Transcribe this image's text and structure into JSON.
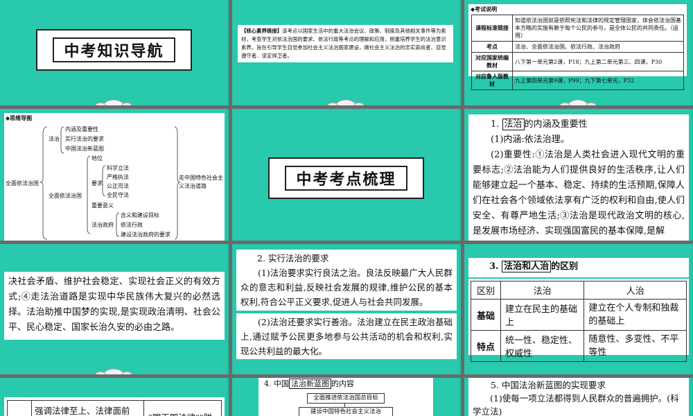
{
  "slide1": {
    "banner_title": "中考知识导航"
  },
  "slide2": {
    "tag": "【核心素养链接】",
    "text": "该考点以国家生活中的重大法治会议、政策、制度及其他相关事件等为素材，考查学生对依法治国的要求、依法行政等考点的理解和应用，侧重培养学生的法治意识素养。旨在引导学生自觉参加社会主义法治国家建设，做社会主义法治的忠实崇尚者、自觉遵守者、坚定捍卫者。"
  },
  "slide3": {
    "header": "◆考试说明",
    "rows": [
      {
        "label": "课程标准链接",
        "value": "知道依法治国就是依照宪法和法律的规定管理国家，体会依法治国基本方略的实施有赖于每个公民的参与，是全体公民的共同责任。（运用）"
      },
      {
        "label": "考点",
        "value": "法治、全面依法治国、依法行政、法治政府"
      },
      {
        "label": "对应国家统编教材",
        "value": "八下第一单元第2课，P18；九上第二单元第三、四课，P30"
      },
      {
        "label": "对应鲁人版教材",
        "value": "九上第四单元第9课，P99；九下第七单元，P32"
      }
    ]
  },
  "slide4": {
    "header": "◆思维导图",
    "root": "全面依法治国",
    "branch1": "法治",
    "branch1_items": [
      "内涵及重要性",
      "实行法治的要求",
      "中国法治新蓝图"
    ],
    "branch2": "全面依法治国",
    "b2_pos": "地位",
    "b2_req": "要求",
    "b2_req_items": [
      "科学立法",
      "严格执法",
      "公正司法",
      "全民守法"
    ],
    "b2_sig": "重要意义",
    "b2_gov": "法治政府",
    "b2_gov_items": [
      "含义和建设目标",
      "依法行政",
      "建设法治政府的要求"
    ],
    "conclusion": "走中国特色社会主义法治道路"
  },
  "slide5": {
    "banner_title": "中考考点梳理"
  },
  "slide6": {
    "heading_num": "1.",
    "heading_key": "法治",
    "heading_rest": "的内涵及重要性",
    "p1": "(1)内涵:依法治理。",
    "p2": "(2)重要性:①法治是人类社会进入现代文明的重要标志;②法治能为人们提供良好的生活秩序,让人们能够建立起一个基本、稳定、持续的生活预期,保障人们在社会各个领域依法享有广泛的权利和自由,使人们安全、有尊严地生活;③法治是现代政治文明的核心,是发展市场经济、实现强国富民的基本保障,是解"
  },
  "slide7": {
    "text": "决社会矛盾、维护社会稳定、实现社会正义的有效方式;④走法治道路是实现中华民族伟大复兴的必然选择。法治助推中国梦的实现,是实现政治清明、社会公平、民心稳定、国家长治久安的必由之路。"
  },
  "slide8": {
    "heading": "2. 实行法治的要求",
    "p1": "(1)法治要求实行良法之治。良法反映最广大人民群众的意志和利益,反映社会发展的规律,维护公民的基本权利,符合公平正义要求,促进人与社会共同发展。",
    "p2": "(2)法治还要求实行善治。法治建立在民主政治基础上,通过赋予公民更多地参与公共活动的机会和权利,实现公共利益的最大化。"
  },
  "slide9": {
    "heading_num": "3.",
    "heading_key": "法治和人治",
    "heading_rest": "的区别",
    "columns": [
      "区别",
      "法治",
      "人治"
    ],
    "rows": [
      [
        "基础",
        "建立在民主的基础上",
        "建立在个人专制和独裁的基础上"
      ],
      [
        "特点",
        "统一性、稳定性、权威性",
        "随意性、多变性、不平等性"
      ]
    ]
  },
  "slide10": {
    "cell1": "强调法律至上、法律面前",
    "cell2": "\"国王即法律\"\"朕"
  },
  "slide11": {
    "heading_num": "4. 中国",
    "heading_key": "法治新蓝图",
    "heading_rest": "的内容",
    "box1": "全面推进依法治国总目标",
    "box2": "建设中国特色社会主义法治"
  },
  "slide12": {
    "heading": "5. 中国法治新蓝图的实现要求",
    "p1": "(1)使每一项立法都得到人民群众的普遍拥护。(科学立法)"
  }
}
